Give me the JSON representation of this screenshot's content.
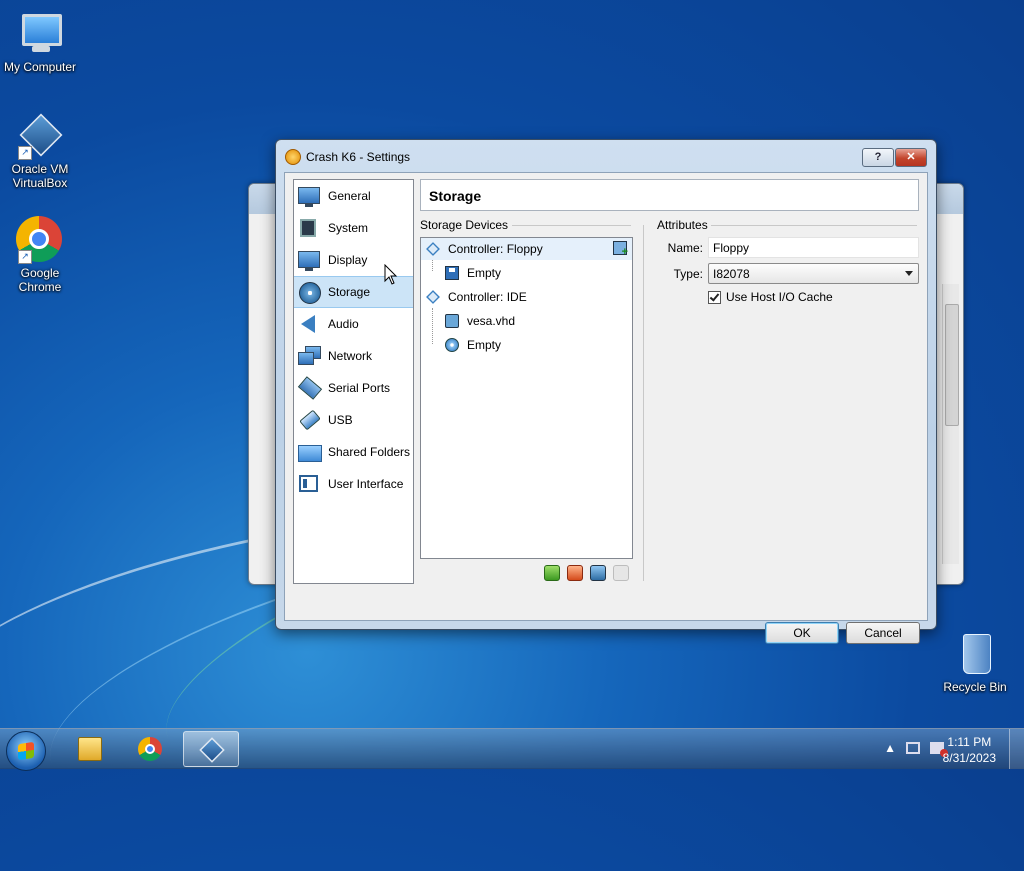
{
  "desktop": {
    "icons": [
      {
        "label": "My Computer",
        "icon": "computer-icon"
      },
      {
        "label": "Oracle VM VirtualBox",
        "icon": "virtualbox-icon"
      },
      {
        "label": "Google Chrome",
        "icon": "chrome-icon"
      },
      {
        "label": "Recycle Bin",
        "icon": "recycle-bin-icon"
      }
    ]
  },
  "dialog": {
    "title": "Crash K6 - Settings",
    "help_label": "?",
    "close_label": "✕",
    "categories": [
      {
        "label": "General",
        "icon": "general-icon"
      },
      {
        "label": "System",
        "icon": "system-icon"
      },
      {
        "label": "Display",
        "icon": "display-icon"
      },
      {
        "label": "Storage",
        "icon": "storage-icon",
        "selected": true
      },
      {
        "label": "Audio",
        "icon": "audio-icon"
      },
      {
        "label": "Network",
        "icon": "network-icon"
      },
      {
        "label": "Serial Ports",
        "icon": "serial-ports-icon"
      },
      {
        "label": "USB",
        "icon": "usb-icon"
      },
      {
        "label": "Shared Folders",
        "icon": "shared-folders-icon"
      },
      {
        "label": "User Interface",
        "icon": "user-interface-icon"
      }
    ],
    "page_title": "Storage",
    "storage_devices_label": "Storage Devices",
    "tree": {
      "floppy_controller": "Controller: Floppy",
      "floppy_empty": "Empty",
      "ide_controller": "Controller: IDE",
      "ide_disk": "vesa.vhd",
      "ide_empty": "Empty"
    },
    "attributes": {
      "group_label": "Attributes",
      "name_label": "Name:",
      "name_value": "Floppy",
      "type_label": "Type:",
      "type_value": "I82078",
      "host_cache_label": "Use Host I/O Cache",
      "host_cache_checked": true
    },
    "ok_label": "OK",
    "cancel_label": "Cancel"
  },
  "taskbar": {
    "apps": [
      "file-explorer-icon",
      "chrome-icon",
      "virtualbox-icon"
    ],
    "time": "1:11 PM",
    "date": "8/31/2023"
  }
}
